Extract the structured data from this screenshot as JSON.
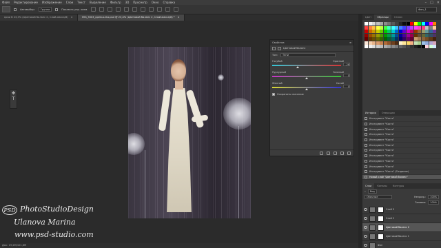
{
  "menubar": {
    "items": [
      "Файл",
      "Редактирование",
      "Изображение",
      "Слои",
      "Текст",
      "Выделение",
      "Фильтр",
      "3D",
      "Просмотр",
      "Окно",
      "Справка"
    ],
    "window_controls": [
      "–",
      "□",
      "✕"
    ]
  },
  "options": {
    "autoselect_label": "Автовыбор:",
    "autoselect_value": "Группа",
    "show_controls_label": "Показать упр. элем.",
    "workspace": "Фон_1"
  },
  "tabs": [
    {
      "label": "краи В 23,3% (Цветовой баланс 2, Слой-маска/8)",
      "active": false
    },
    {
      "label": "IMG_3503_крем-Ьл1о.psd @ 23,4% (Цветовой баланс 2, Слой-маска/8) *",
      "active": true
    }
  ],
  "tab_close": "×",
  "status": "Док: 19,2M/101,6M",
  "properties": {
    "title": "Свойства",
    "subtitle": "Цветовой баланс",
    "tone_label": "Тон:",
    "tone_value": "Тени",
    "sliders": [
      {
        "left": "Голубой",
        "right": "Красный",
        "value": "-26",
        "position": 0.37,
        "gradient": [
          "#33c8d8",
          "#d83333"
        ]
      },
      {
        "left": "Пурпурный",
        "right": "Зеленый",
        "value": "0",
        "position": 0.5,
        "gradient": [
          "#c833c8",
          "#33c833"
        ]
      },
      {
        "left": "Желтый",
        "right": "Синий",
        "value": "0",
        "position": 0.5,
        "gradient": [
          "#d8d833",
          "#3333d8"
        ]
      }
    ],
    "preserve_label": "Сохранить свечение",
    "preserve_checked": true
  },
  "right": {
    "swatch_tabs": [
      "Цвет",
      "Образцы",
      "Стили"
    ],
    "swatch_active": 1,
    "history_tabs": [
      "История",
      "Операции"
    ],
    "history_active": 0,
    "history": [
      "Инструмент \"Кисть\"",
      "Инструмент \"Кисть\"",
      "Инструмент \"Кисть\"",
      "Инструмент \"Кисть\"",
      "Инструмент \"Кисть\"",
      "Инструмент \"Кисть\"",
      "Инструмент \"Кисть\"",
      "Инструмент \"Кисть\"",
      "Инструмент \"Кисть\"",
      "Инструмент \"Кисть\"",
      "Инструмент \"Кисть\" (Создание)",
      "Новый слой \"Цветовой баланс\""
    ],
    "history_active_index": 11,
    "layer_tabs": [
      "Слои",
      "Каналы",
      "Контуры"
    ],
    "layer_active": 0,
    "filter_kind": "Вид",
    "blend_mode": "Обычные",
    "opacity_label": "Непрозр.:",
    "opacity_value": "100%",
    "fill_label": "Заливка:",
    "fill_value": "100%",
    "layers": [
      {
        "name": "Слой 3",
        "active": false
      },
      {
        "name": "Слой 2",
        "active": false
      },
      {
        "name": "Цветовой баланс 2",
        "active": true
      },
      {
        "name": "Цветовой баланс 1",
        "active": false
      },
      {
        "name": "Фон",
        "active": false
      }
    ]
  },
  "watermark": {
    "logo": "PSD",
    "line1": "PhotoStudioDesign",
    "line2": "Ulanova Marina",
    "line3": "www.psd-studio.com"
  },
  "swatch_colors": [
    "#ffffff",
    "#f2f2f2",
    "#d9d9d9",
    "#bfbfbf",
    "#a6a6a6",
    "#8c8c8c",
    "#737373",
    "#595959",
    "#404040",
    "#262626",
    "#0d0d0d",
    "#000000",
    "#ff0000",
    "#ffff00",
    "#00ff00",
    "#00ffff",
    "#0000ff",
    "#ff00ff",
    "#ff8000",
    "#ff4040",
    "#ff8040",
    "#ffbf40",
    "#ffff40",
    "#bfff40",
    "#40ff40",
    "#40ffbf",
    "#40ffff",
    "#40bfff",
    "#4080ff",
    "#4040ff",
    "#8040ff",
    "#bf40ff",
    "#ff40ff",
    "#ff40bf",
    "#ff4080",
    "#c0c0c0",
    "#808080",
    "#ffcc99",
    "#cc0000",
    "#cc6600",
    "#cc9900",
    "#cccc00",
    "#66cc00",
    "#00cc00",
    "#00cc66",
    "#00cccc",
    "#0066cc",
    "#0000cc",
    "#6600cc",
    "#cc00cc",
    "#cc0066",
    "#993300",
    "#996633",
    "#999966",
    "#669999",
    "#336699",
    "#663399",
    "#990000",
    "#994c00",
    "#997300",
    "#999900",
    "#4c9900",
    "#009900",
    "#00994c",
    "#009999",
    "#004c99",
    "#000099",
    "#4c0099",
    "#990099",
    "#99004c",
    "#663300",
    "#664d33",
    "#666633",
    "#336666",
    "#334d66",
    "#4d3366",
    "#660000",
    "#663300",
    "#664d00",
    "#666600",
    "#336600",
    "#006600",
    "#006633",
    "#006666",
    "#003366",
    "#000066",
    "#330066",
    "#660066",
    "#660033",
    "#c69c6d",
    "#a67c52",
    "#8c6239",
    "#754c24",
    "#603913",
    "#42210b",
    "#fbe8d8",
    "#f5cfae",
    "#e8b48a",
    "#d99a6c",
    "#c7834f",
    "#b06b38",
    "#8f5428",
    "#6e3f1c",
    "#4d2b12",
    "#fff2cc",
    "#ffe699",
    "#ffd966",
    "#f4b183",
    "#c5e0b4",
    "#a9d18e",
    "#9dc3e6",
    "#8faadc",
    "#b4a7d6",
    "#d5a6bd",
    "#ffffff",
    "#eeeeee",
    "#dddddd",
    "#cccccc",
    "#bbbbbb",
    "#aaaaaa",
    "#999999",
    "#888888",
    "#777777",
    "#666666",
    "#555555",
    "#444444",
    "#333333",
    "#222222",
    "#111111",
    "#000000",
    "#ffd1dc",
    "#d1ffd6",
    "#d1e8ff"
  ]
}
